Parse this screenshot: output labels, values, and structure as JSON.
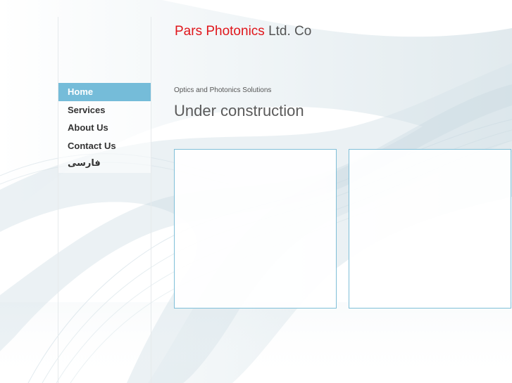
{
  "header": {
    "brand": "Pars Photonics",
    "suffix": "Ltd. Co"
  },
  "nav": {
    "items": [
      {
        "label": "Home",
        "active": true
      },
      {
        "label": "Services",
        "active": false
      },
      {
        "label": "About Us",
        "active": false
      },
      {
        "label": "Contact Us",
        "active": false
      },
      {
        "label": "فارسی",
        "active": false
      }
    ]
  },
  "main": {
    "tagline": "Optics and Photonics Solutions",
    "heading": "Under construction"
  },
  "colors": {
    "brand_red": "#e0161b",
    "nav_active": "#75bcd9",
    "panel_border": "#7fbfd8",
    "text_gray": "#555555"
  }
}
